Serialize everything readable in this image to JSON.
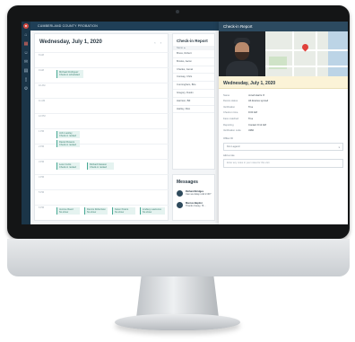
{
  "app": {
    "title": "CUMBERLAND COUNTY PROBATION"
  },
  "sidebar": {
    "items": [
      {
        "icon": "home-icon",
        "glyph": "⌂"
      },
      {
        "icon": "calendar-icon",
        "glyph": "▦"
      },
      {
        "icon": "people-icon",
        "glyph": "☺"
      },
      {
        "icon": "message-icon",
        "glyph": "✉"
      },
      {
        "icon": "chart-icon",
        "glyph": "▤"
      },
      {
        "icon": "document-icon",
        "glyph": "▯"
      },
      {
        "icon": "settings-icon",
        "glyph": "⚙"
      }
    ]
  },
  "calendar": {
    "date_title": "Wednesday, July 1, 2020",
    "nav": "‹ ›",
    "hours": [
      "8 AM",
      "9 AM",
      "10 AM",
      "11 AM",
      "12 PM",
      "1 PM",
      "2 PM",
      "3 PM",
      "4 PM",
      "5 PM",
      "6 PM"
    ],
    "events": [
      {
        "text": "Michael Rodriguez\nCheck-in scheduled"
      },
      {
        "text": "John Lastley\nCheck-in ranked"
      },
      {
        "text": "Daniel Flowers\nCheck-in ranked"
      },
      {
        "text": "Leon Curtis\nCheck-in ranked"
      },
      {
        "text": "Richard Dawson\nCheck-in ranked"
      },
      {
        "text": "Jerome Reed\nNo show"
      },
      {
        "text": "Dennis Robertson\nNo show"
      },
      {
        "text": "Karen Peters\nNo show"
      },
      {
        "text": "Lindsey Lawrence\nNo show"
      }
    ]
  },
  "checkin_list": {
    "title": "Check-in Report",
    "column": "Name ▲",
    "rows": [
      "Bruce, Robert",
      "Brooks, Aaron",
      "Charles, Jamal",
      "Conway, Chris",
      "Cunningham, Brie",
      "Gregory, Dustin",
      "Harrison, Bill",
      "Hartley, Rico"
    ]
  },
  "messages": {
    "title": "Messages",
    "items": [
      {
        "name": "Richard Bridges",
        "preview": "Can we delay until 2:30?"
      },
      {
        "name": "Marcus Baptist",
        "preview": "Thanks Casey, I'll…"
      }
    ]
  },
  "report": {
    "header": "Check-in Report",
    "date": "Wednesday, July 1, 2020",
    "fields": [
      {
        "k": "Name",
        "v": "Jonah Harris  ☑"
      },
      {
        "k": "Device status",
        "v": "All devices synced"
      },
      {
        "k": "Verification",
        "v": "True"
      },
      {
        "k": "Check-in time",
        "v": "9:00 AM"
      },
      {
        "k": "Face matched",
        "v": "True"
      },
      {
        "k": "Reporting",
        "v": "Contact 9:12 AM"
      },
      {
        "k": "Verification code",
        "v": "4382"
      }
    ],
    "select_label": "Officer ID",
    "select_value": "Kim Legend",
    "note_label": "Add a note",
    "note_placeholder": "Enter any notes in your notes for this visit"
  },
  "colors": {
    "topbar": "#1f3f57",
    "accent": "#47a994",
    "pin": "#e0403a",
    "date_highlight": "#fbf3d7"
  }
}
